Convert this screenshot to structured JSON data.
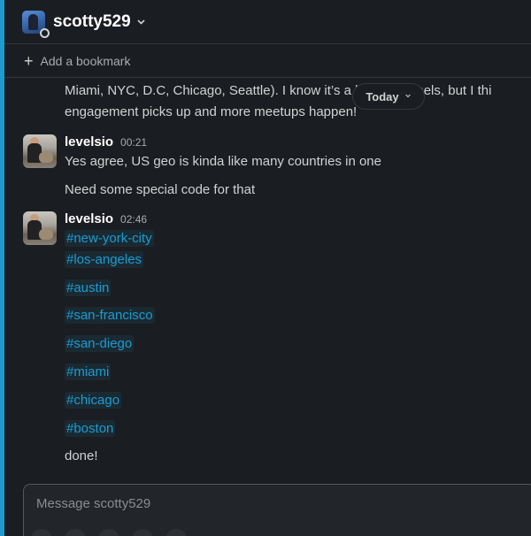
{
  "header": {
    "title": "scotty529"
  },
  "bookmark": {
    "label": "Add a bookmark"
  },
  "continuation": {
    "line1": "Miami, NYC, D.C, Chicago, Seattle).  I know it’s a lot of channels, but I thi",
    "line2": "engagement picks up and more meetups happen!"
  },
  "date_divider": {
    "label": "Today"
  },
  "messages": [
    {
      "author": "levelsio",
      "time": "00:21",
      "lines": [
        "Yes agree, US geo is kinda like many countries in one",
        "Need some special code for that"
      ]
    },
    {
      "author": "levelsio",
      "time": "02:46",
      "channels": [
        "#new-york-city",
        "#los-angeles",
        "#austin",
        "#san-francisco",
        "#san-diego",
        "#miami",
        "#chicago",
        "#boston"
      ],
      "closing": "done!"
    }
  ],
  "composer": {
    "placeholder": "Message scotty529"
  },
  "colors": {
    "background": "#1a1d21",
    "accent": "#1d9bd1",
    "text": "#d1d2d3"
  }
}
